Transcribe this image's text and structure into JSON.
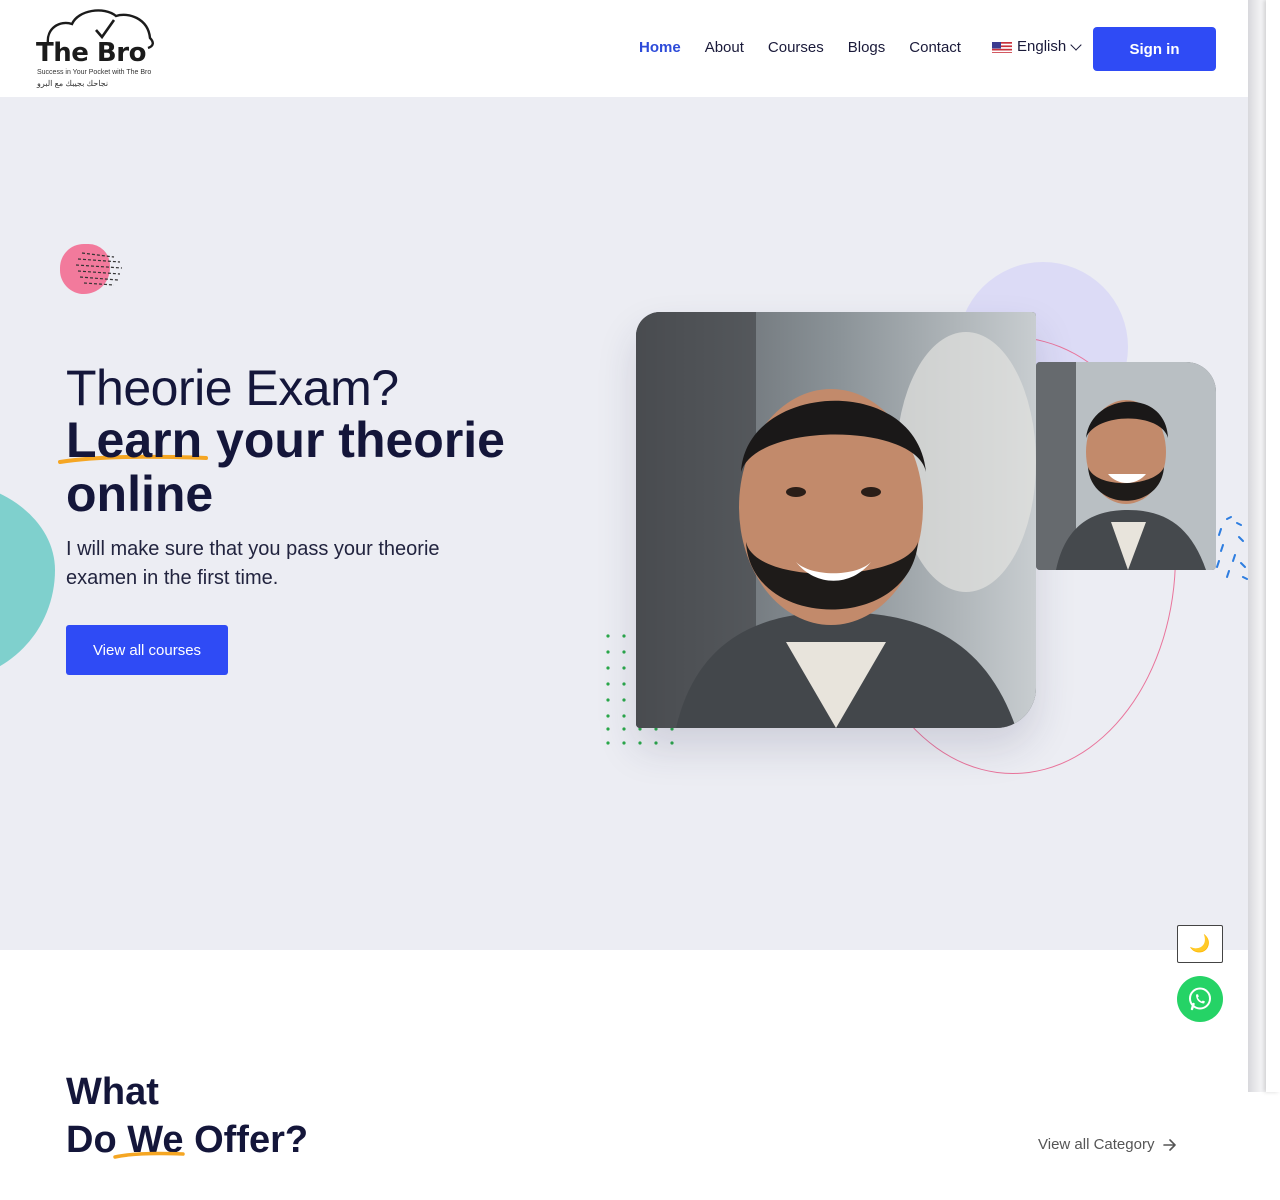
{
  "brand": {
    "name": "The Bro",
    "tagline": "Success in Your Pocket with The Bro",
    "tagline_ar": "نجاحك بجيبك مع البرو"
  },
  "nav": {
    "items": [
      "Home",
      "About",
      "Courses",
      "Blogs",
      "Contact"
    ],
    "active": "Home",
    "language": "English",
    "signin_label": "Sign in"
  },
  "hero": {
    "line1": "Theorie Exam?",
    "line2": "Learn your theorie online",
    "subtitle": "I will make sure that you pass your theorie examen in the first time.",
    "cta_label": "View all courses"
  },
  "floating": {
    "dark_mode_icon": "moon-icon",
    "chat_icon": "whatsapp-icon"
  },
  "offer": {
    "title_line1": "What",
    "title_line2": "Do We Offer?",
    "view_all_label": "View all Category"
  },
  "colors": {
    "primary": "#2f4bf5",
    "hero_bg": "#ecedf3",
    "heading": "#14163a",
    "accent_underline": "#f5a623",
    "teal": "#7fd0cd",
    "pink": "#f27a9c",
    "whatsapp": "#25d366"
  }
}
